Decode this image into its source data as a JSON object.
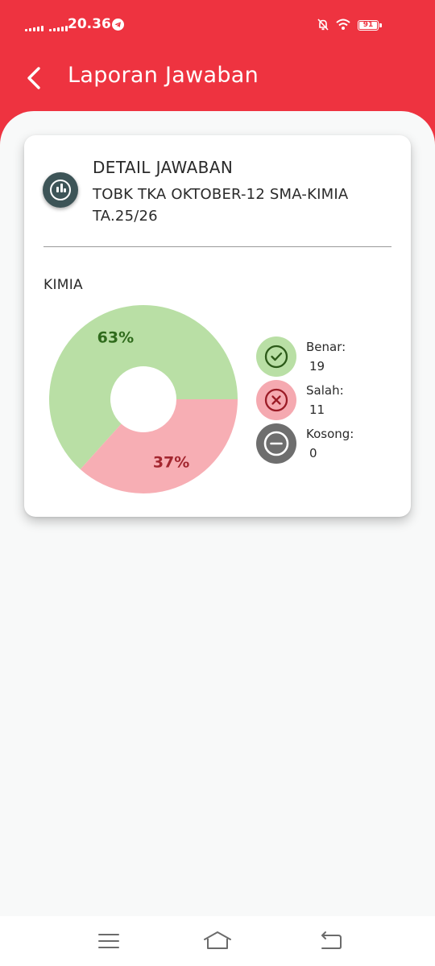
{
  "status_bar": {
    "time": "20.36",
    "battery": "91",
    "icons": [
      "signal-icon",
      "signal-icon",
      "telegram-icon",
      "mute-icon",
      "wifi-icon",
      "battery-icon"
    ]
  },
  "app_bar": {
    "title": "Laporan Jawaban",
    "back_icon": "chevron-left-icon"
  },
  "card": {
    "icon": "bar-chart-icon",
    "title": "DETAIL JAWABAN",
    "subtitle": "TOBK TKA OKTOBER-12 SMA-KIMIA TA.25/26",
    "subject": "KIMIA"
  },
  "legend": [
    {
      "label": "Benar:",
      "value": "19",
      "icon": "check-icon",
      "color": "#b9dfa5"
    },
    {
      "label": "Salah:",
      "value": "11",
      "icon": "close-icon",
      "color": "#f5a9b0"
    },
    {
      "label": "Kosong:",
      "value": "0",
      "icon": "minus-icon",
      "color": "#6e6e6e"
    }
  ],
  "chart_data": {
    "type": "pie",
    "donut": true,
    "categories": [
      "Benar",
      "Salah",
      "Kosong"
    ],
    "values": [
      19,
      11,
      0
    ],
    "slice_labels": [
      "63%",
      "37%",
      ""
    ],
    "colors": [
      "#b9dfa5",
      "#f7aeb4",
      "#6e6e6e"
    ],
    "label_colors": [
      "#2f6b1c",
      "#a3262f",
      "#ffffff"
    ],
    "title": ""
  },
  "nav_bar": {
    "icons": [
      "menu-icon",
      "home-icon",
      "back-icon"
    ]
  }
}
